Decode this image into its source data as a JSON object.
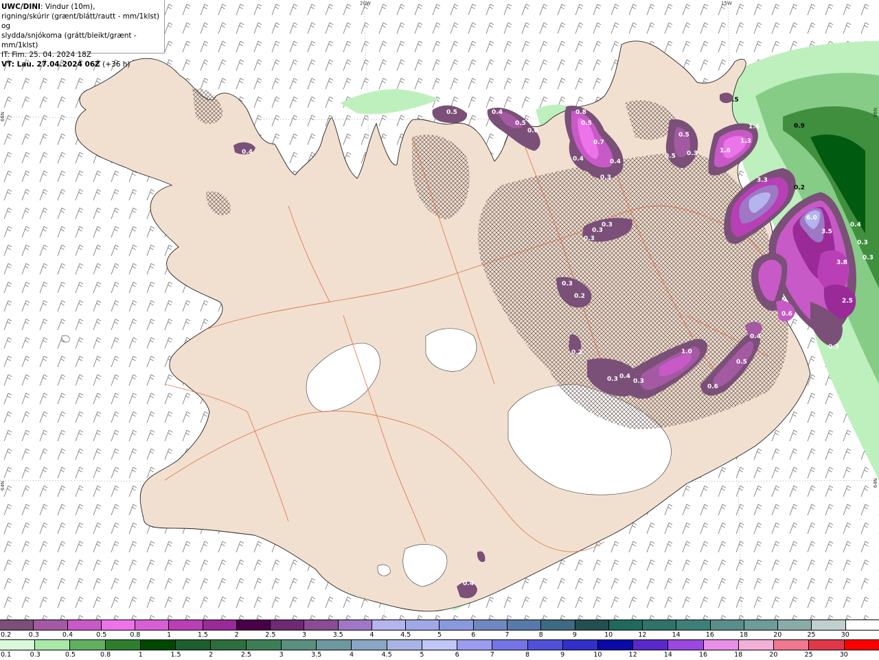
{
  "header": {
    "line1_bold": "UWC/DINI",
    "line1_rest": ": Vindur (10m),",
    "line2": "rigning/skúrir (grænt/blátt/rautt - mm/1klst) og",
    "line3": "slydda/snjókoma (grátt/bleikt/grænt - mm/1klst)",
    "line4": "IT: Fim. 25. 04. 2024 18Z",
    "line5_bold": "VT: Lau. 27.04.2024 06Z",
    "line5_rest": " (+36 h)"
  },
  "grid_labels": {
    "lon_20w": "20W",
    "lon_15w": "15W",
    "lat_66n_left": "66N",
    "lat_66n_right": "66N",
    "lat_64n_left": "64N",
    "lat_64n_right": "64N"
  },
  "map_values": [
    {
      "label": "0.4",
      "dark": false
    },
    {
      "label": "0.5",
      "dark": false
    },
    {
      "label": "0.4",
      "dark": false
    },
    {
      "label": "0.5",
      "dark": false
    },
    {
      "label": "0.6",
      "dark": false
    },
    {
      "label": "0.8",
      "dark": false
    },
    {
      "label": "0.5",
      "dark": false
    },
    {
      "label": "0.7",
      "dark": false
    },
    {
      "label": "0.4",
      "dark": false
    },
    {
      "label": "0.4",
      "dark": false
    },
    {
      "label": "0.3",
      "dark": false
    },
    {
      "label": "0.5",
      "dark": false
    },
    {
      "label": "0.3",
      "dark": false
    },
    {
      "label": "0.5",
      "dark": false
    },
    {
      "label": "1.4",
      "dark": false
    },
    {
      "label": "1.6",
      "dark": false
    },
    {
      "label": "1.3",
      "dark": false
    },
    {
      "label": "0.9",
      "dark": true
    },
    {
      "label": ".5",
      "dark": true
    },
    {
      "label": "0.2",
      "dark": true
    },
    {
      "label": "3.3",
      "dark": false
    },
    {
      "label": "6.0",
      "dark": false
    },
    {
      "label": "3.5",
      "dark": false
    },
    {
      "label": "0.4",
      "dark": false
    },
    {
      "label": "0.3",
      "dark": false
    },
    {
      "label": "0.3",
      "dark": false
    },
    {
      "label": "3.8",
      "dark": false
    },
    {
      "label": "2.5",
      "dark": false
    },
    {
      "label": "0.6",
      "dark": false
    },
    {
      "label": "0.3",
      "dark": false
    },
    {
      "label": "0.3",
      "dark": false
    },
    {
      "label": "0.3",
      "dark": false
    },
    {
      "label": "0.3",
      "dark": false
    },
    {
      "label": "0.3",
      "dark": false
    },
    {
      "label": "0.2",
      "dark": false
    },
    {
      "label": "0.2",
      "dark": false
    },
    {
      "label": "0.3",
      "dark": false
    },
    {
      "label": "0.4",
      "dark": false
    },
    {
      "label": "0.3",
      "dark": false
    },
    {
      "label": "1.0",
      "dark": false
    },
    {
      "label": "0.4",
      "dark": false
    },
    {
      "label": "0.5",
      "dark": false
    },
    {
      "label": "0.6",
      "dark": false
    },
    {
      "label": "0.4",
      "dark": false
    }
  ],
  "legend_snow": {
    "labels": [
      "0.2",
      "0.3",
      "0.4",
      "0.5",
      "0.8",
      "1",
      "1.5",
      "2",
      "2.5",
      "3",
      "3.5",
      "4",
      "4.5",
      "5",
      "6",
      "7",
      "8",
      "9",
      "10",
      "12",
      "14",
      "16",
      "18",
      "20",
      "25",
      "30"
    ],
    "colors": [
      "#7a4f78",
      "#a459a3",
      "#c75ac6",
      "#ec73ea",
      "#d65fd4",
      "#b83fb6",
      "#9a2a98",
      "#4a0048",
      "#6e2a72",
      "#8a4c92",
      "#9e78c4",
      "#b4b4ee",
      "#a0a8e8",
      "#8a98dc",
      "#6f88c0",
      "#587aa8",
      "#3e6a84",
      "#22504e",
      "#1f6a5a",
      "#2e7468",
      "#3e8078",
      "#5a8e8a",
      "#6e9c98",
      "#8aaca8",
      "#c0d0ce",
      "#ffffff"
    ]
  },
  "legend_rain": {
    "labels": [
      "0.1",
      "0.3",
      "0.5",
      "0.8",
      "1",
      "1.5",
      "2",
      "2.5",
      "3",
      "3.5",
      "4",
      "4.5",
      "5",
      "6",
      "7",
      "8",
      "9",
      "10",
      "12",
      "14",
      "16",
      "18",
      "20",
      "25",
      "30"
    ],
    "colors": [
      "#d8f8d8",
      "#a8e8a8",
      "#60b060",
      "#2e7e2e",
      "#004800",
      "#1e5e2e",
      "#2e6e3e",
      "#3e7e56",
      "#5a8e7e",
      "#6e98a0",
      "#8aa6c4",
      "#a8b4e4",
      "#c0c6f6",
      "#9c9cf0",
      "#7474e6",
      "#5050d8",
      "#3030c8",
      "#0a0aa8",
      "#5a28c8",
      "#9a48e0",
      "#e890e8",
      "#f4b0d8",
      "#f07890",
      "#e03848",
      "#ff0000"
    ]
  }
}
